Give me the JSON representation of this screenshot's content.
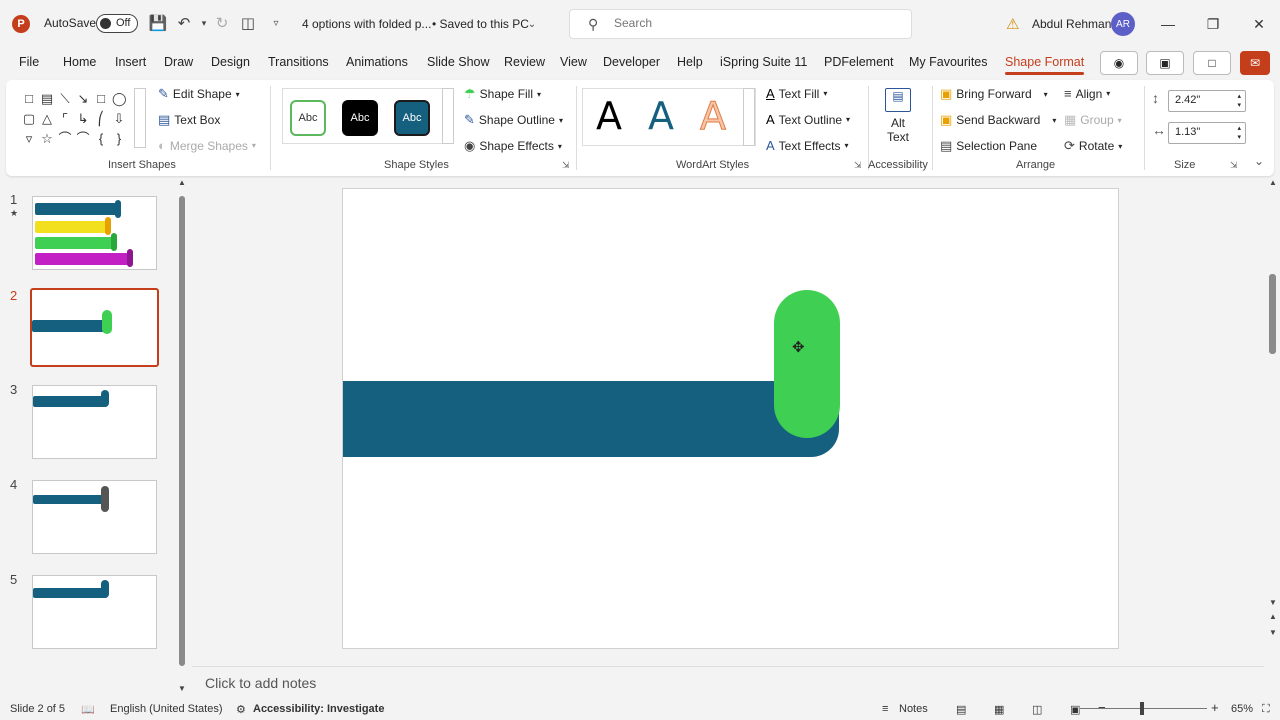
{
  "titlebar": {
    "app_logo": "P",
    "autosave_label": "AutoSave",
    "autosave_state": "Off",
    "document_title": "4 options with folded p...",
    "saved_status": "• Saved to this PC",
    "search_placeholder": "Search",
    "user_name": "Abdul Rehman",
    "user_initials": "AR"
  },
  "tabs": [
    "File",
    "Home",
    "Insert",
    "Draw",
    "Design",
    "Transitions",
    "Animations",
    "Slide Show",
    "Review",
    "View",
    "Developer",
    "Help",
    "iSpring Suite 11",
    "PDFelement",
    "My Favourites",
    "Shape Format"
  ],
  "active_tab": "Shape Format",
  "ribbon": {
    "insert_shapes": {
      "label": "Insert Shapes",
      "edit_shape": "Edit Shape",
      "text_box": "Text Box",
      "merge_shapes": "Merge Shapes"
    },
    "shape_styles": {
      "label": "Shape Styles",
      "swatch_text": "Abc",
      "shape_fill": "Shape Fill",
      "shape_outline": "Shape Outline",
      "shape_effects": "Shape Effects"
    },
    "wordart_styles": {
      "label": "WordArt Styles",
      "letter": "A",
      "text_fill": "Text Fill",
      "text_outline": "Text Outline",
      "text_effects": "Text Effects"
    },
    "accessibility": {
      "label": "Accessibility",
      "alt_text_line1": "Alt",
      "alt_text_line2": "Text"
    },
    "arrange": {
      "label": "Arrange",
      "bring_forward": "Bring Forward",
      "send_backward": "Send Backward",
      "selection_pane": "Selection Pane",
      "align": "Align",
      "group": "Group",
      "rotate": "Rotate"
    },
    "size": {
      "label": "Size",
      "height": "2.42\"",
      "width": "1.13\""
    }
  },
  "slides": [
    {
      "number": "1",
      "star": "★"
    },
    {
      "number": "2"
    },
    {
      "number": "3"
    },
    {
      "number": "4"
    },
    {
      "number": "5"
    }
  ],
  "active_slide": 2,
  "colors": {
    "accent": "#c43e1c",
    "band": "#16607f",
    "pill": "#3fcf52"
  },
  "notes_placeholder": "Click to add notes",
  "statusbar": {
    "slide_info": "Slide 2 of 5",
    "language": "English (United States)",
    "accessibility": "Accessibility: Investigate",
    "notes": "Notes",
    "zoom": "65%"
  }
}
